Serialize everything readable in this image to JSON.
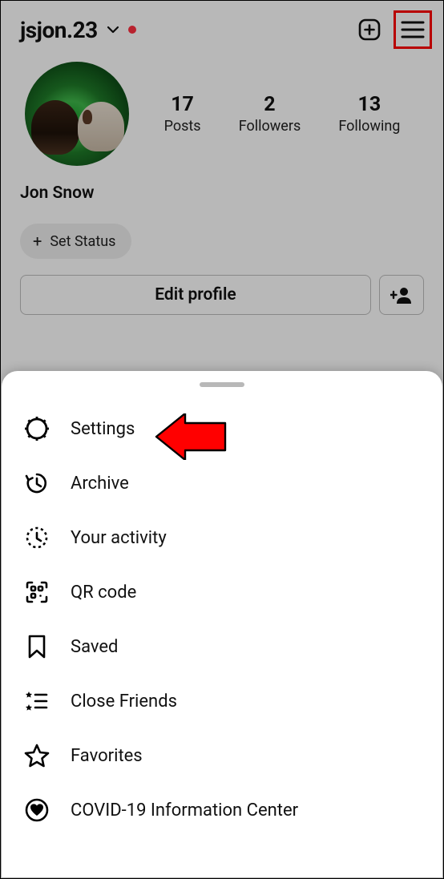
{
  "header": {
    "username": "jsjon.23",
    "has_notification_dot": true
  },
  "profile": {
    "stats": [
      {
        "value": "17",
        "label": "Posts"
      },
      {
        "value": "2",
        "label": "Followers"
      },
      {
        "value": "13",
        "label": "Following"
      }
    ],
    "display_name": "Jon Snow",
    "status_label": "Set Status",
    "edit_label": "Edit profile"
  },
  "menu": {
    "items": [
      {
        "label": "Settings"
      },
      {
        "label": "Archive"
      },
      {
        "label": "Your activity"
      },
      {
        "label": "QR code"
      },
      {
        "label": "Saved"
      },
      {
        "label": "Close Friends"
      },
      {
        "label": "Favorites"
      },
      {
        "label": "COVID-19 Information Center"
      }
    ]
  }
}
